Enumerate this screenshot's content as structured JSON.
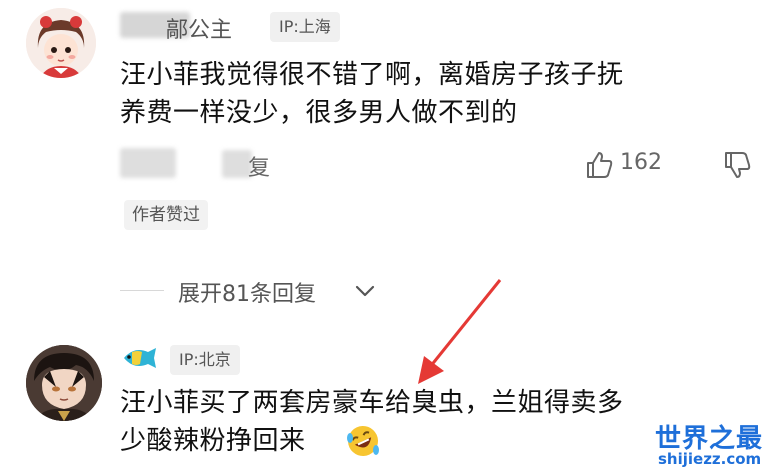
{
  "comments": [
    {
      "username": "鄗公主",
      "ip_label": "IP:上海",
      "text_line1": "汪小菲我觉得很不错了啊，离婚房子孩子抚",
      "text_line2": "养费一样没少，很多男人做不到的",
      "reply_label": "复",
      "like_count": "162",
      "author_tag": "作者赞过",
      "icons": [
        "thumbs-up-icon",
        "thumbs-down-icon"
      ]
    },
    {
      "ip_label": "IP:北京",
      "text_line1": "汪小菲买了两套房豪车给臭虫，兰姐得卖多",
      "text_line2": "少酸辣粉挣回来",
      "icons": [
        "fish-icon",
        "laughing-emoji-icon"
      ]
    }
  ],
  "expand_replies": "展开81条回复",
  "watermark": {
    "title": "世界之最",
    "domain": "shijiezz.com"
  },
  "colors": {
    "annotation_arrow": "#e53935",
    "watermark": "#1e6fd9"
  }
}
